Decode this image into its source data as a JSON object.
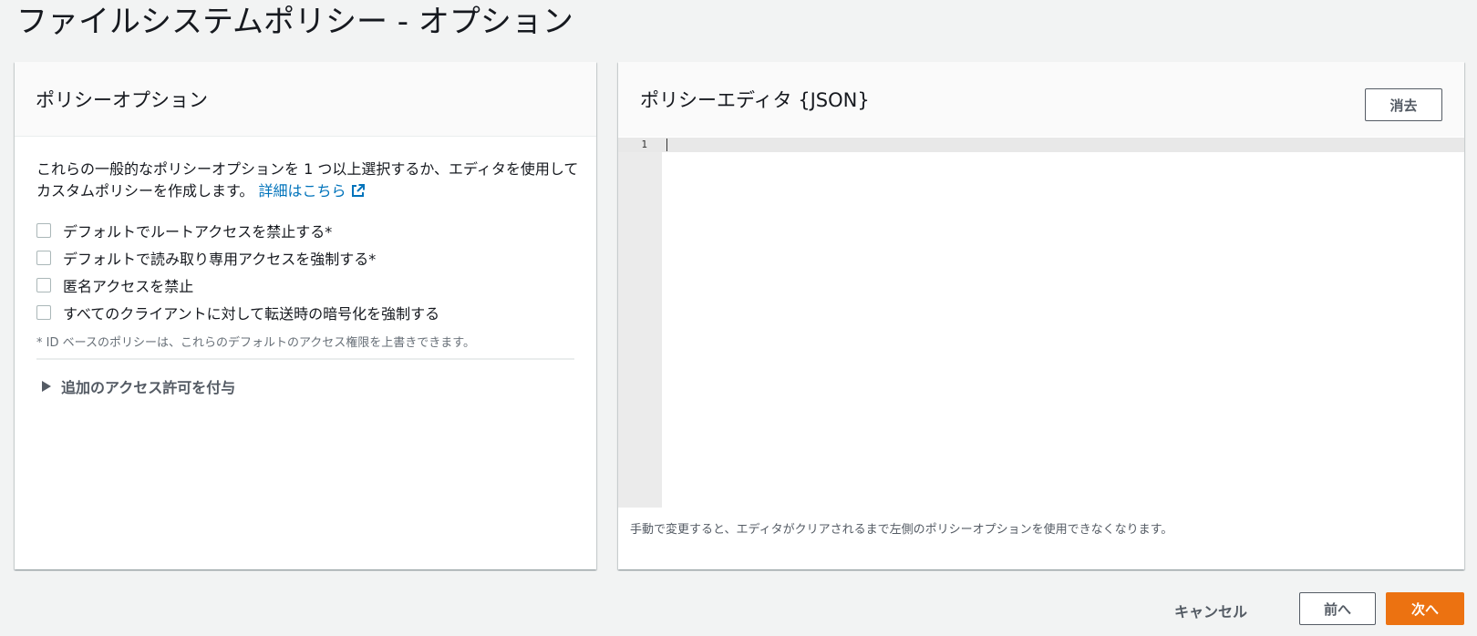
{
  "page": {
    "title": "ファイルシステムポリシー - オプション"
  },
  "left_panel": {
    "title": "ポリシーオプション",
    "description": "これらの一般的なポリシーオプションを 1 つ以上選択するか、エディタを使用してカスタムポリシーを作成します。",
    "learn_more_link": "詳細はこちら",
    "options": [
      {
        "label": "デフォルトでルートアクセスを禁止する*",
        "checked": false
      },
      {
        "label": "デフォルトで読み取り専用アクセスを強制する*",
        "checked": false
      },
      {
        "label": "匿名アクセスを禁止",
        "checked": false
      },
      {
        "label": "すべてのクライアントに対して転送時の暗号化を強制する",
        "checked": false
      }
    ],
    "footnote": "* ID ベースのポリシーは、これらのデフォルトのアクセス権限を上書きできます。",
    "expander_label": "追加のアクセス許可を付与"
  },
  "right_panel": {
    "title": "ポリシーエディタ {JSON}",
    "clear_button": "消去",
    "editor": {
      "line_numbers": [
        "1"
      ],
      "content": ""
    },
    "note": "手動で変更すると、エディタがクリアされるまで左側のポリシーオプションを使用できなくなります。"
  },
  "footer": {
    "cancel_label": "キャンセル",
    "prev_label": "前へ",
    "next_label": "次へ"
  },
  "colors": {
    "accent": "#ec7211",
    "link": "#0073bb"
  },
  "icons": {
    "external_link": "external-link-icon",
    "expand": "caret-right-icon"
  }
}
